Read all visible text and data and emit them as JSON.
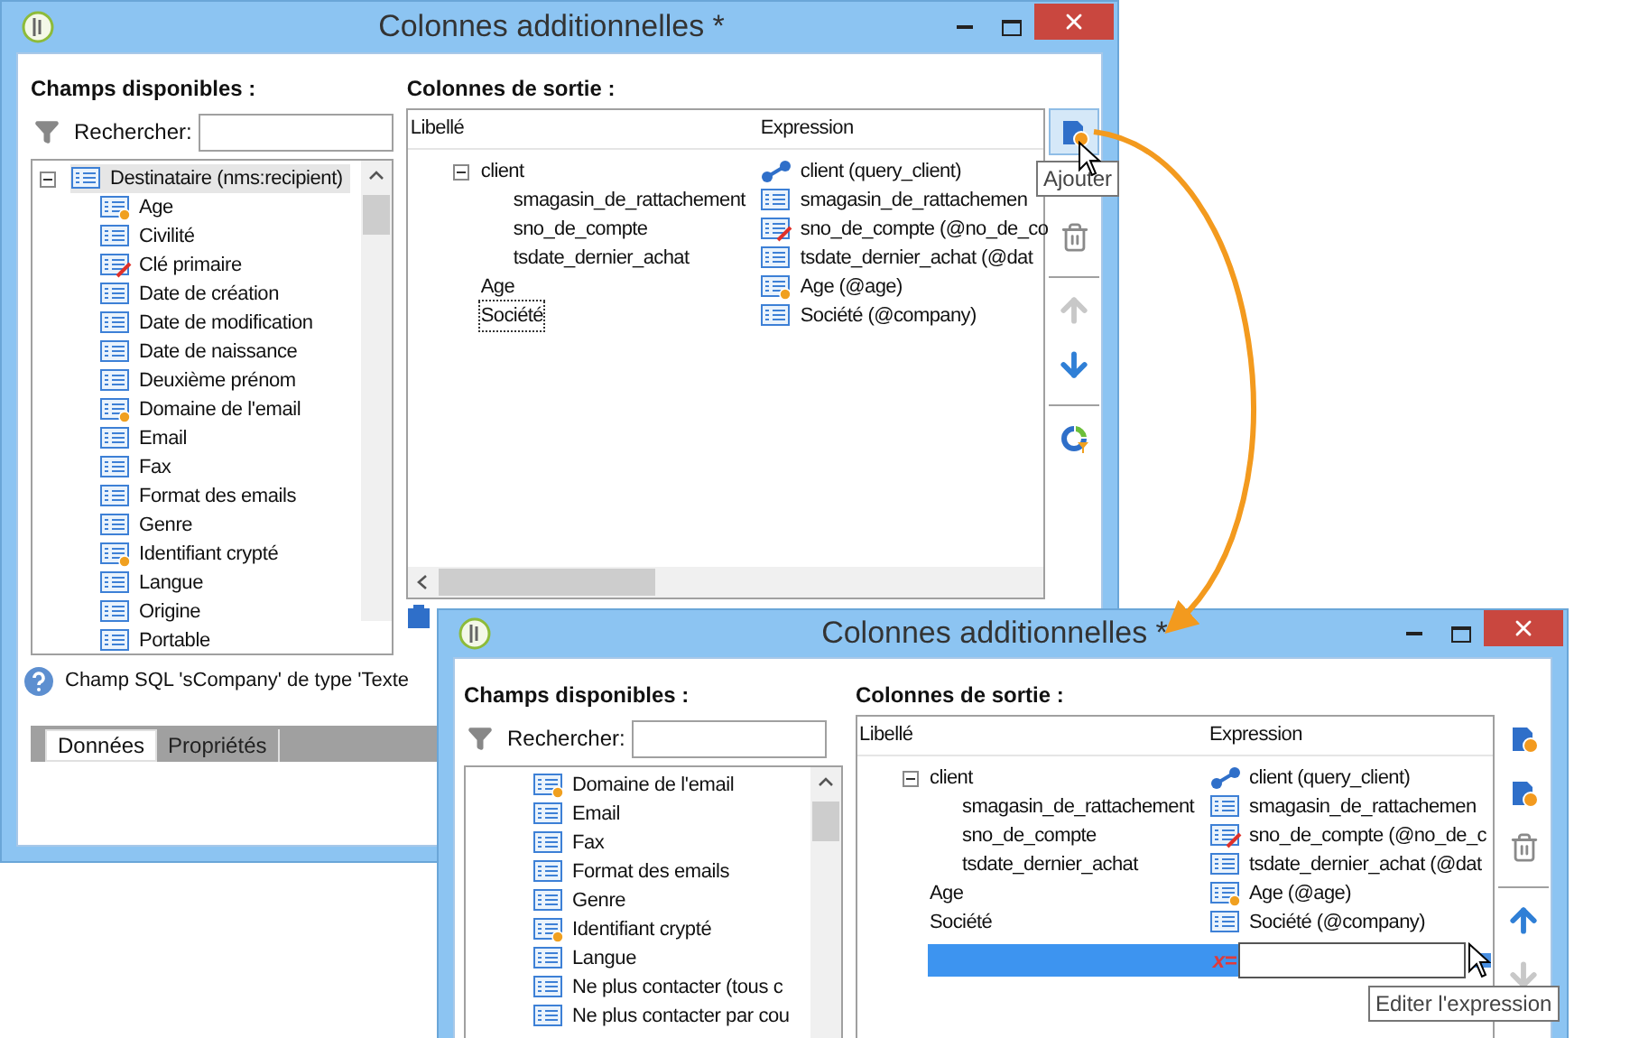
{
  "windows": [
    {
      "title": "Colonnes additionnelles *",
      "available_fields": {
        "heading": "Champs disponibles :",
        "search_label": "Rechercher:",
        "tree": [
          {
            "label": "Destinataire (nms:recipient)",
            "kind": "table",
            "expanded": true,
            "selected": true,
            "children": [
              {
                "label": "Age",
                "kind": "computed"
              },
              {
                "label": "Civilité",
                "kind": "field"
              },
              {
                "label": "Clé primaire",
                "kind": "key"
              },
              {
                "label": "Date de création",
                "kind": "field"
              },
              {
                "label": "Date de modification",
                "kind": "field"
              },
              {
                "label": "Date de naissance",
                "kind": "field"
              },
              {
                "label": "Deuxième prénom",
                "kind": "field"
              },
              {
                "label": "Domaine de l'email",
                "kind": "computed"
              },
              {
                "label": "Email",
                "kind": "field"
              },
              {
                "label": "Fax",
                "kind": "field"
              },
              {
                "label": "Format des emails",
                "kind": "field"
              },
              {
                "label": "Genre",
                "kind": "field"
              },
              {
                "label": "Identifiant crypté",
                "kind": "computed"
              },
              {
                "label": "Langue",
                "kind": "field"
              },
              {
                "label": "Origine",
                "kind": "field"
              },
              {
                "label": "Portable",
                "kind": "field"
              }
            ]
          }
        ]
      },
      "output": {
        "heading": "Colonnes de sortie :",
        "columns": [
          "Libellé",
          "Expression"
        ],
        "rows": [
          {
            "label": "client",
            "expression": "client (query_client)",
            "kind": "link",
            "expanded": true,
            "selected": false,
            "children": [
              {
                "label": "smagasin_de_rattachement",
                "expression": "smagasin_de_rattachemen",
                "kind": "field",
                "selected": false
              },
              {
                "label": "sno_de_compte",
                "expression": "sno_de_compte (@no_de_co",
                "kind": "key",
                "selected": false
              },
              {
                "label": "tsdate_dernier_achat",
                "expression": "tsdate_dernier_achat (@dat",
                "kind": "field",
                "selected": false
              }
            ]
          },
          {
            "label": "Age",
            "expression": "Age (@age)",
            "kind": "computed",
            "selected": false
          },
          {
            "label": "Société",
            "expression": "Société (@company)",
            "kind": "field",
            "selected": true
          }
        ]
      },
      "toolbar": [
        {
          "kind": "add",
          "disabled": false,
          "hovered": true
        },
        {
          "kind": "delete",
          "disabled": false,
          "hovered": false
        },
        {
          "kind": "up",
          "disabled": true,
          "hovered": false
        },
        {
          "kind": "down",
          "disabled": false,
          "hovered": false
        },
        {
          "kind": "distribution",
          "disabled": false,
          "hovered": false
        }
      ],
      "tooltip": "Ajouter",
      "help_text": "Champ SQL 'sCompany' de type 'Texte",
      "tabs": [
        {
          "label": "Données",
          "selected": true
        },
        {
          "label": "Propriétés",
          "selected": false
        }
      ]
    },
    {
      "title": "Colonnes additionnelles *",
      "available_fields": {
        "heading": "Champs disponibles :",
        "search_label": "Rechercher:",
        "tree": [
          {
            "label": "Domaine de l'email",
            "kind": "computed"
          },
          {
            "label": "Email",
            "kind": "field"
          },
          {
            "label": "Fax",
            "kind": "field"
          },
          {
            "label": "Format des emails",
            "kind": "field"
          },
          {
            "label": "Genre",
            "kind": "field"
          },
          {
            "label": "Identifiant crypté",
            "kind": "computed"
          },
          {
            "label": "Langue",
            "kind": "field"
          },
          {
            "label": "Ne plus contacter (tous c",
            "kind": "field"
          },
          {
            "label": "Ne plus contacter par cou",
            "kind": "field"
          }
        ]
      },
      "output": {
        "heading": "Colonnes de sortie :",
        "columns": [
          "Libellé",
          "Expression"
        ],
        "rows": [
          {
            "label": "client",
            "expression": "client (query_client)",
            "kind": "link",
            "expanded": true,
            "selected": false,
            "children": [
              {
                "label": "smagasin_de_rattachement",
                "expression": "smagasin_de_rattachemen",
                "kind": "field",
                "selected": false
              },
              {
                "label": "sno_de_compte",
                "expression": "sno_de_compte (@no_de_c",
                "kind": "key",
                "selected": false
              },
              {
                "label": "tsdate_dernier_achat",
                "expression": "tsdate_dernier_achat (@dat",
                "kind": "field",
                "selected": false
              }
            ]
          },
          {
            "label": "Age",
            "expression": "Age (@age)",
            "kind": "computed",
            "selected": false
          },
          {
            "label": "Société",
            "expression": "Société (@company)",
            "kind": "field",
            "selected": false
          }
        ],
        "new_row": {
          "marker": "x="
        }
      },
      "toolbar": [
        {
          "kind": "add",
          "disabled": false,
          "hovered": false
        },
        {
          "kind": "add",
          "disabled": false,
          "hovered": false
        },
        {
          "kind": "delete",
          "disabled": false,
          "hovered": false
        },
        {
          "kind": "up",
          "disabled": false,
          "hovered": false
        },
        {
          "kind": "down",
          "disabled": true,
          "hovered": false
        }
      ],
      "tooltip": "Editer l'expression"
    }
  ]
}
